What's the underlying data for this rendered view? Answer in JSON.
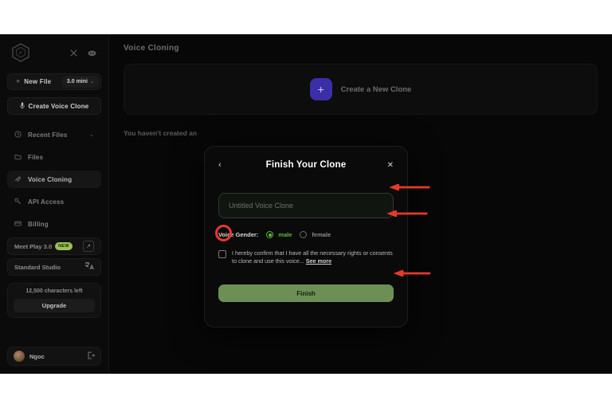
{
  "sidebar": {
    "logo_icon": "cube-logo-icon",
    "social": [
      {
        "name": "x-twitter-icon",
        "label": "X"
      },
      {
        "name": "discord-icon",
        "label": "Discord"
      }
    ],
    "new_file": {
      "label": "New File",
      "plus": "+",
      "model": "3.0 mini",
      "caret": "⌄"
    },
    "create_clone": {
      "label": "Create Voice Clone",
      "icon": "microphone-icon"
    },
    "nav": [
      {
        "label": "Recent Files",
        "icon": "clock-icon",
        "chevron": "⌄",
        "active": false
      },
      {
        "label": "Files",
        "icon": "folder-icon",
        "chevron": "",
        "active": false
      },
      {
        "label": "Voice Cloning",
        "icon": "voice-wave-icon",
        "chevron": "",
        "active": true
      },
      {
        "label": "API Access",
        "icon": "key-icon",
        "chevron": "",
        "active": false
      },
      {
        "label": "Billing",
        "icon": "card-icon",
        "chevron": "",
        "active": false
      }
    ],
    "promo": {
      "label": "Meet Play 3.0",
      "badge": "NEW",
      "icon": "external-link-icon"
    },
    "studio": {
      "label": "Standard Studio",
      "icon": "translate-icon"
    },
    "quota": {
      "text": "12,500 characters left",
      "upgrade_label": "Upgrade"
    },
    "user": {
      "name": "Ngoc",
      "logout_icon": "logout-icon",
      "avatar": "user-avatar"
    }
  },
  "main": {
    "page_title": "Voice Cloning",
    "create_card": {
      "plus": "+",
      "label": "Create a New Clone"
    },
    "empty_text": "You haven't created an"
  },
  "modal": {
    "back": "‹",
    "title": "Finish Your Clone",
    "close": "✕",
    "name_placeholder": "Untitled Voice Clone",
    "gender_label": "Voice Gender:",
    "options": [
      {
        "label": "male",
        "selected": true
      },
      {
        "label": "female",
        "selected": false
      }
    ],
    "consent_text": "I hereby confirm that I have all the necessary rights or consents to clone and use this voice...",
    "see_more": "See more",
    "finish_label": "Finish",
    "accent_green": "#5dbb3a",
    "finish_color": "#6d8f55"
  },
  "annotations": {
    "highlight_color": "#e8392a",
    "arrow_count": 3,
    "ring_target": "consent-checkbox"
  }
}
